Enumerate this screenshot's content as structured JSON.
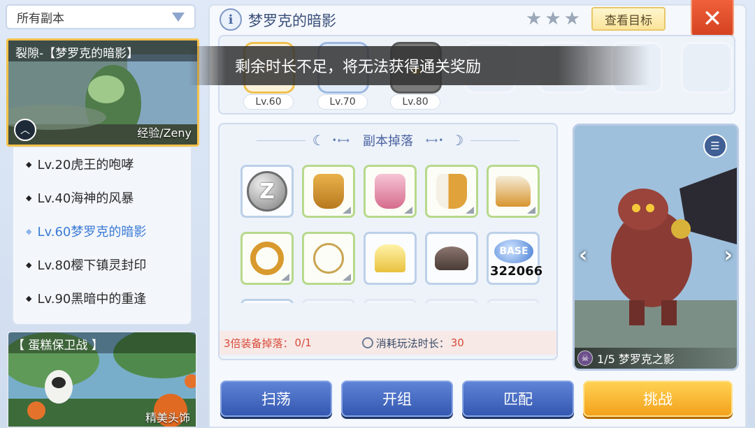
{
  "dropdown": {
    "label": "所有副本"
  },
  "selected_dungeon": {
    "title": "裂隙-【梦罗克的暗影】",
    "tag": "经验/Zeny"
  },
  "dungeon_list": [
    {
      "label": "Lv.20虎王的咆哮",
      "active": false
    },
    {
      "label": "Lv.40海神的风暴",
      "active": false
    },
    {
      "label": "Lv.60梦罗克的暗影",
      "active": true
    },
    {
      "label": "Lv.80樱下镇灵封印",
      "active": false
    },
    {
      "label": "Lv.90黑暗中的重逢",
      "active": false
    }
  ],
  "event_card": {
    "title": "【 蛋糕保卫战 】",
    "tag": "精美头饰"
  },
  "header": {
    "title": "梦罗克的暗影",
    "stars_earned": 0,
    "stars_total": 3,
    "goal_button": "查看目标",
    "close_icon": "close-x"
  },
  "rewards": {
    "levels": [
      "Lv.60",
      "Lv.70",
      "Lv.80"
    ]
  },
  "toast": {
    "message": "剩余时长不足，将无法获得通关奖励"
  },
  "drops": {
    "title": "副本掉落",
    "base_value": "322066",
    "footer": {
      "equip_label": "3倍装备掉落：",
      "equip_value": "0/1",
      "time_label": "消耗玩法时长：",
      "time_value": "30"
    }
  },
  "boss": {
    "caption": "1/5 梦罗克之影"
  },
  "actions": {
    "sweep": "扫荡",
    "team": "开组",
    "match": "匹配",
    "challenge": "挑战"
  }
}
